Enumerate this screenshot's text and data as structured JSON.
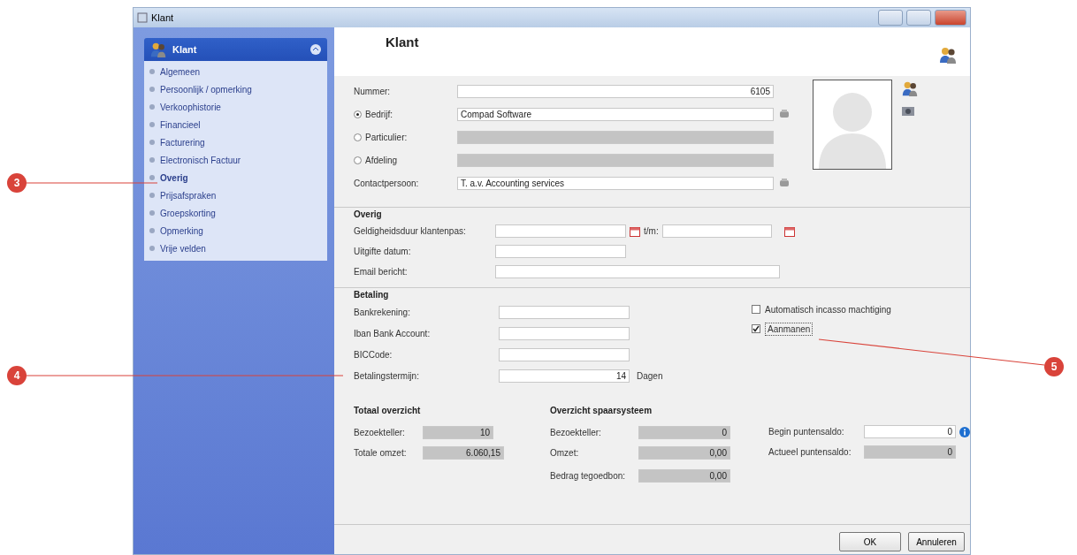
{
  "window": {
    "title": "Klant"
  },
  "sidebar": {
    "title": "Klant",
    "items": [
      {
        "label": "Algemeen",
        "selected": false
      },
      {
        "label": "Persoonlijk / opmerking",
        "selected": false
      },
      {
        "label": "Verkoophistorie",
        "selected": false
      },
      {
        "label": "Financieel",
        "selected": false
      },
      {
        "label": "Facturering",
        "selected": false
      },
      {
        "label": "Electronisch Factuur",
        "selected": false
      },
      {
        "label": "Overig",
        "selected": true
      },
      {
        "label": "Prijsafspraken",
        "selected": false
      },
      {
        "label": "Groepskorting",
        "selected": false
      },
      {
        "label": "Opmerking",
        "selected": false
      },
      {
        "label": "Vrije velden",
        "selected": false
      }
    ]
  },
  "header": {
    "title": "Klant"
  },
  "general": {
    "number": {
      "label": "Nummer:",
      "value": "6105"
    },
    "relations": [
      {
        "label": "Bedrijf:",
        "selected": true,
        "value": "Compad Software",
        "disabled": false
      },
      {
        "label": "Particulier:",
        "selected": false,
        "disabled": true
      },
      {
        "label": "Afdeling",
        "selected": false,
        "disabled": true
      }
    ],
    "contact": {
      "label": "Contactpersoon:",
      "value": "T. a.v. Accounting services"
    }
  },
  "overig": {
    "title": "Overig",
    "validity_label": "Geldigheidsduur klantenpas:",
    "until_label": "t/m:",
    "issue_label": "Uitgifte datum:",
    "email_label": "Email bericht:"
  },
  "betaling": {
    "title": "Betaling",
    "fields": [
      {
        "label": "Bankrekening:"
      },
      {
        "label": "Iban Bank Account:"
      },
      {
        "label": "BICCode:"
      },
      {
        "label": "Betalingstermijn:",
        "value": "14",
        "unit": "Dagen"
      }
    ],
    "checks": [
      {
        "label": "Automatisch incasso machtiging",
        "checked": false
      },
      {
        "label": "Aanmanen",
        "checked": true
      }
    ]
  },
  "totaal": {
    "title": "Totaal overzicht",
    "rows": [
      {
        "label": "Bezoekteller:",
        "value": "10"
      },
      {
        "label": "Totale omzet:",
        "value": "6.060,15"
      }
    ]
  },
  "spaar": {
    "title": "Overzicht spaarsysteem",
    "rows": [
      {
        "label": "Bezoekteller:",
        "value": "0"
      },
      {
        "label": "Omzet:",
        "value": "0,00"
      },
      {
        "label": "Bedrag tegoedbon:",
        "value": "0,00"
      }
    ],
    "points": [
      {
        "label": "Begin puntensaldo:",
        "value": "0",
        "disabled": false
      },
      {
        "label": "Actueel puntensaldo:",
        "value": "0",
        "disabled": true
      }
    ]
  },
  "buttons": [
    "OK",
    "Annuleren"
  ],
  "callouts": [
    {
      "number": "3"
    },
    {
      "number": "4"
    },
    {
      "number": "5"
    }
  ]
}
